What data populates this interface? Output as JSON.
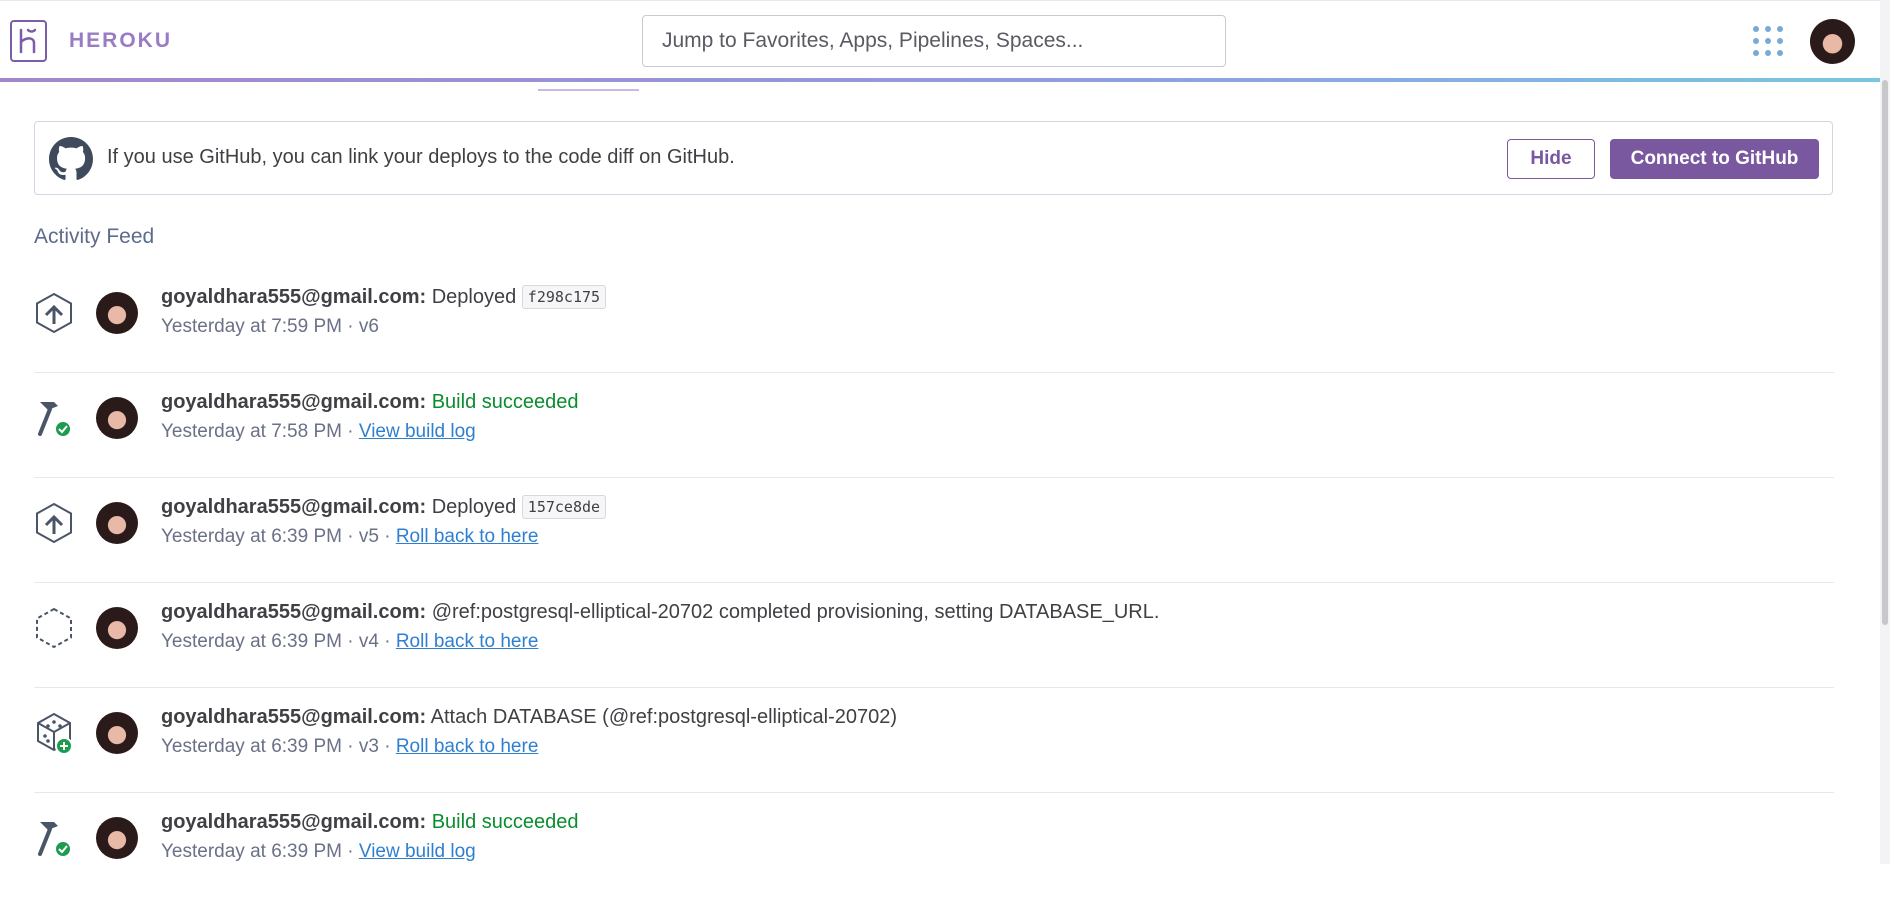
{
  "header": {
    "logo_text": "HEROKU",
    "search_placeholder": "Jump to Favorites, Apps, Pipelines, Spaces..."
  },
  "github_banner": {
    "text": "If you use GitHub, you can link your deploys to the code diff on GitHub.",
    "hide_label": "Hide",
    "connect_label": "Connect to GitHub"
  },
  "activity": {
    "title": "Activity Feed",
    "items": [
      {
        "icon": "deploy-icon",
        "user": "goyaldhara555@gmail.com:",
        "action": "Deployed",
        "commit": "f298c175",
        "time": "Yesterday at 7:59 PM",
        "version": "· v6"
      },
      {
        "icon": "build-icon",
        "user": "goyaldhara555@gmail.com:",
        "status": "Build succeeded",
        "time": "Yesterday at 7:58 PM",
        "link": "View build log"
      },
      {
        "icon": "deploy-icon",
        "user": "goyaldhara555@gmail.com:",
        "action": "Deployed",
        "commit": "157ce8de",
        "time": "Yesterday at 6:39 PM",
        "version": "· v5 ·",
        "link": "Roll back to here"
      },
      {
        "icon": "provision-icon",
        "user": "goyaldhara555@gmail.com:",
        "action": "@ref:postgresql-elliptical-20702 completed provisioning, setting DATABASE_URL.",
        "time": "Yesterday at 6:39 PM",
        "version": "· v4 ·",
        "link": "Roll back to here"
      },
      {
        "icon": "addon-attach-icon",
        "user": "goyaldhara555@gmail.com:",
        "action": "Attach DATABASE (@ref:postgresql-elliptical-20702)",
        "time": "Yesterday at 6:39 PM",
        "version": "· v3 ·",
        "link": "Roll back to here"
      },
      {
        "icon": "build-icon",
        "user": "goyaldhara555@gmail.com:",
        "status": "Build succeeded",
        "time": "Yesterday at 6:39 PM",
        "link": "View build log"
      }
    ]
  },
  "colors": {
    "brand_purple": "#79589f",
    "success_green": "#0a8d2e",
    "link_blue": "#2f7fd1"
  }
}
